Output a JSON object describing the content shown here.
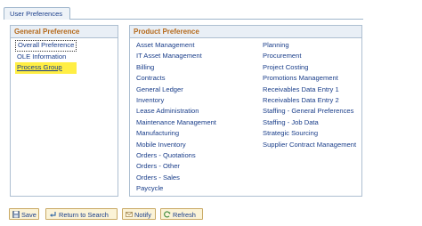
{
  "tab": {
    "label": "User Preferences"
  },
  "general": {
    "header": "General Preference",
    "items": [
      "Overall Preference",
      "OLE Information",
      "Process Group"
    ]
  },
  "product": {
    "header": "Product Preference",
    "col1": [
      "Asset Management",
      "IT Asset Management",
      "Billing",
      "Contracts",
      "General Ledger",
      "Inventory",
      "Lease Administration",
      "Maintenance Management",
      "Manufacturing",
      "Mobile Inventory",
      "Orders - Quotations",
      "Orders - Other",
      "Orders - Sales",
      "Paycycle"
    ],
    "col2": [
      "Planning",
      "Procurement",
      "Project Costing",
      "Promotions Management",
      "Receivables Data Entry 1",
      "Receivables Data Entry 2",
      "Staffing - General Preferences",
      "Staffing - Job Data",
      "Strategic Sourcing",
      "Supplier Contract Management"
    ]
  },
  "toolbar": {
    "save": "Save",
    "return": "Return to Search",
    "notify": "Notify",
    "refresh": "Refresh"
  },
  "icons": {
    "save": "save-icon",
    "return": "return-icon",
    "notify": "notify-icon",
    "refresh": "refresh-icon"
  },
  "colors": {
    "link": "#1a3e8a",
    "header_text": "#b56a1c",
    "highlight": "#ffee44"
  }
}
